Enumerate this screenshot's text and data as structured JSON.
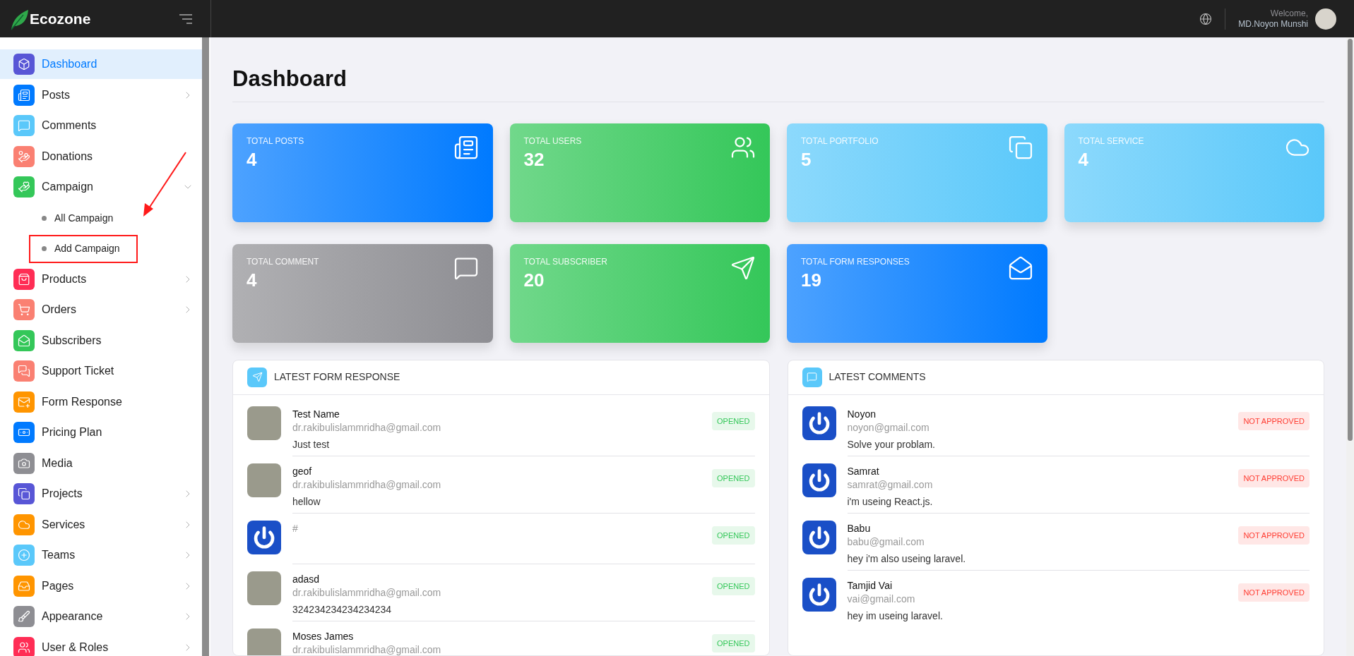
{
  "header": {
    "brand": "Ecozone",
    "welcome": "Welcome,",
    "user_name": "MD.Noyon Munshi"
  },
  "sidebar": {
    "items": [
      {
        "label": "Dashboard",
        "color": "#5856d6",
        "selected": true
      },
      {
        "label": "Posts",
        "color": "#007aff",
        "selected": false,
        "expanded": false
      },
      {
        "label": "Comments",
        "color": "#5ac8fa",
        "selected": false
      },
      {
        "label": "Donations",
        "color": "#fa8072",
        "selected": false
      },
      {
        "label": "Campaign",
        "color": "#34c759",
        "selected": false,
        "expanded": true,
        "children": [
          {
            "label": "All Campaign",
            "selected": false,
            "annotated": false
          },
          {
            "label": "Add Campaign",
            "selected": false,
            "annotated": true
          }
        ]
      },
      {
        "label": "Products",
        "color": "#ff2d55",
        "selected": false,
        "expanded": false
      },
      {
        "label": "Orders",
        "color": "#fa8072",
        "selected": false,
        "expanded": false
      },
      {
        "label": "Subscribers",
        "color": "#34c759",
        "selected": false
      },
      {
        "label": "Support Ticket",
        "color": "#fa8072",
        "selected": false
      },
      {
        "label": "Form Response",
        "color": "#ff9500",
        "selected": false
      },
      {
        "label": "Pricing Plan",
        "color": "#007aff",
        "selected": false
      },
      {
        "label": "Media",
        "color": "#8e8e93",
        "selected": false
      },
      {
        "label": "Projects",
        "color": "#5856d6",
        "selected": false,
        "expanded": false
      },
      {
        "label": "Services",
        "color": "#ff9500",
        "selected": false,
        "expanded": false
      },
      {
        "label": "Teams",
        "color": "#5ac8fa",
        "selected": false,
        "expanded": false
      },
      {
        "label": "Pages",
        "color": "#ff9500",
        "selected": false,
        "expanded": false
      },
      {
        "label": "Appearance",
        "color": "#8e8e93",
        "selected": false,
        "expanded": false
      },
      {
        "label": "User & Roles",
        "color": "#ff2d55",
        "selected": false,
        "expanded": false
      }
    ]
  },
  "page_title": "Dashboard",
  "stat_cards": [
    {
      "label": "TOTAL POSTS",
      "value": "4",
      "color": "#007aff"
    },
    {
      "label": "TOTAL USERS",
      "value": "32",
      "color": "#34c759"
    },
    {
      "label": "TOTAL PORTFOLIO",
      "value": "5",
      "color": "#5ac8fa"
    },
    {
      "label": "TOTAL SERVICE",
      "value": "4",
      "color": "#5ac8fa"
    },
    {
      "label": "TOTAL COMMENT",
      "value": "4",
      "color": "#8e8e93"
    },
    {
      "label": "TOTAL SUBSCRIBER",
      "value": "20",
      "color": "#34c759"
    },
    {
      "label": "TOTAL FORM RESPONSES",
      "value": "19",
      "color": "#007aff"
    }
  ],
  "panels": [
    {
      "title": "LATEST FORM RESPONSE",
      "rows": [
        {
          "kind": "photo",
          "name": "Test Name",
          "email": "dr.rakibulislammridha@gmail.com",
          "message": "Just test",
          "badge": "OPENED",
          "color": "#34c759"
        },
        {
          "kind": "photo",
          "name": "geof",
          "email": "dr.rakibulislammridha@gmail.com",
          "message": "hellow",
          "badge": "OPENED",
          "color": "#34c759"
        },
        {
          "kind": "logo",
          "email": "#",
          "badge": "OPENED",
          "color": "#34c759"
        },
        {
          "kind": "photo",
          "name": "adasd",
          "email": "dr.rakibulislammridha@gmail.com",
          "message": "324234234234234234",
          "badge": "OPENED",
          "color": "#34c759"
        },
        {
          "kind": "photo",
          "name": "Moses James",
          "email": "dr.rakibulislammridha@gmail.com",
          "badge": "OPENED",
          "color": "#34c759"
        }
      ]
    },
    {
      "title": "LATEST COMMENTS",
      "rows": [
        {
          "kind": "logo",
          "name": "Noyon",
          "email": "noyon@gmail.com",
          "message": "Solve your problam.",
          "badge": "NOT APPROVED",
          "color": "#ff3b30"
        },
        {
          "kind": "logo",
          "name": "Samrat",
          "email": "samrat@gmail.com",
          "message": "i'm useing React.js.",
          "badge": "NOT APPROVED",
          "color": "#ff3b30"
        },
        {
          "kind": "logo",
          "name": "Babu",
          "email": "babu@gmail.com",
          "message": "hey i'm also useing laravel.",
          "badge": "NOT APPROVED",
          "color": "#ff3b30"
        },
        {
          "kind": "logo",
          "name": "Tamjid Vai",
          "email": "vai@gmail.com",
          "message": "hey im useing laravel.",
          "badge": "NOT APPROVED",
          "color": "#ff3b30"
        }
      ]
    }
  ]
}
